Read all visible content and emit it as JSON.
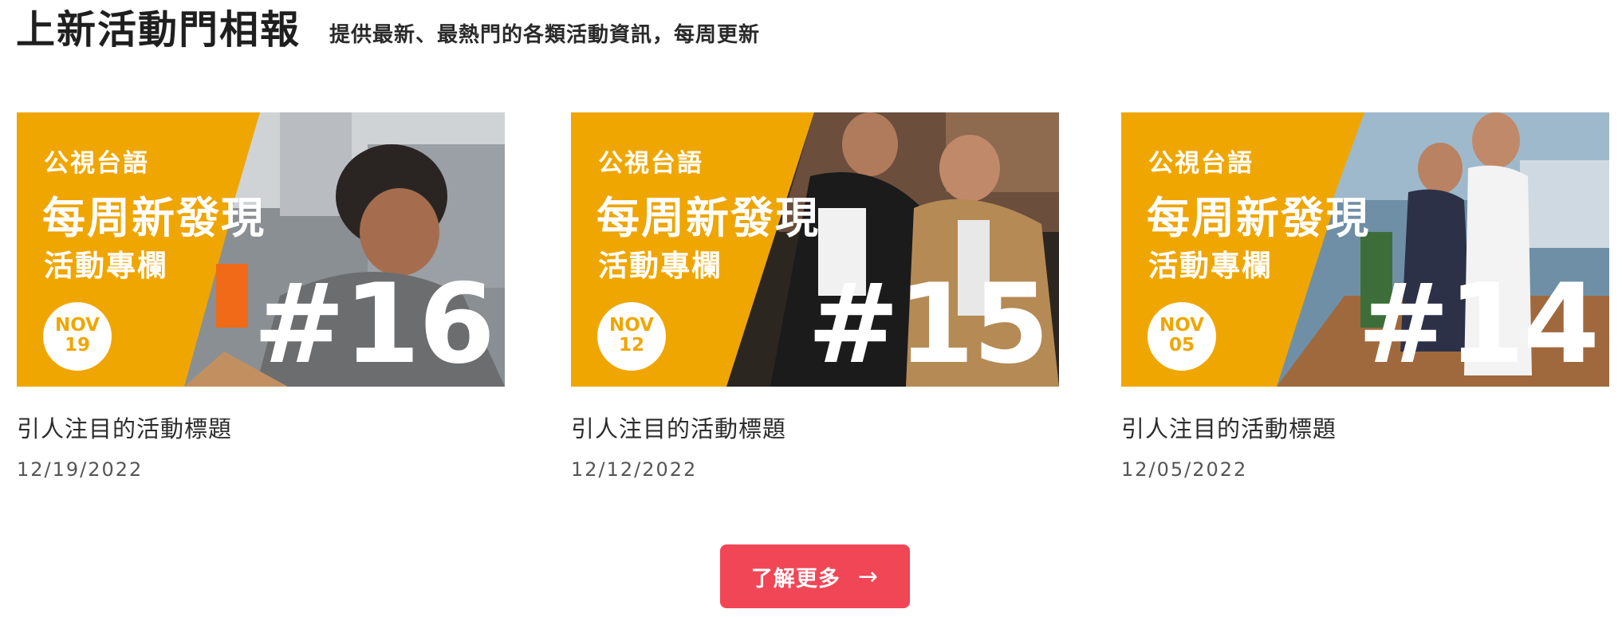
{
  "header": {
    "title": "上新活動門相報",
    "subtitle": "提供最新、最熱門的各類活動資訊，每周更新"
  },
  "cards": [
    {
      "brand": "公視台語",
      "headline": "每周新發現",
      "column": "活動專欄",
      "month": "NOV",
      "day": "19",
      "number": "#16",
      "title": "引人注目的活動標題",
      "date": "12/19/2022"
    },
    {
      "brand": "公視台語",
      "headline": "每周新發現",
      "column": "活動專欄",
      "month": "NOV",
      "day": "12",
      "number": "#15",
      "title": "引人注目的活動標題",
      "date": "12/12/2022"
    },
    {
      "brand": "公視台語",
      "headline": "每周新發現",
      "column": "活動專欄",
      "month": "NOV",
      "day": "05",
      "number": "#14",
      "title": "引人注目的活動標題",
      "date": "12/05/2022"
    }
  ],
  "more_button": {
    "label": "了解更多",
    "icon": "arrow-right-icon",
    "arrow": "→"
  },
  "colors": {
    "accent_orange": "#f0a600",
    "button_red": "#f14656",
    "text_dark": "#1f1f1f"
  }
}
